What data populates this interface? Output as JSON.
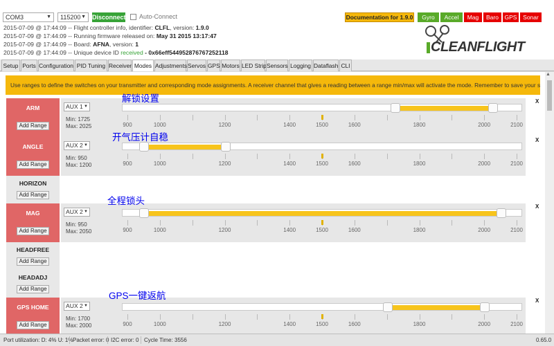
{
  "header": {
    "port_select": "COM3",
    "baud_select": "115200",
    "connect_label": "Disconnect",
    "autoconnect_label": "Auto-Connect",
    "documentation_label": "Documentation for 1.9.0",
    "sensors": [
      {
        "name": "Gyro",
        "color": "#59aa29"
      },
      {
        "name": "Accel",
        "color": "#59aa29"
      },
      {
        "name": "Mag",
        "color": "#e60000"
      },
      {
        "name": "Baro",
        "color": "#e60000"
      },
      {
        "name": "GPS",
        "color": "#e60000"
      },
      {
        "name": "Sonar",
        "color": "#e60000"
      }
    ],
    "logo_text": "CLEANFLIGHT"
  },
  "log": [
    {
      "prefix": "2015-07-09 @ 17:44:09 -- Flight controller info, identifier: ",
      "value": "CLFL",
      "mid": ", version: ",
      "value2": "1.9.0"
    },
    {
      "prefix": "2015-07-09 @ 17:44:09 -- Running firmware released on: ",
      "value": "May 31 2015 13:17:47"
    },
    {
      "prefix": "2015-07-09 @ 17:44:09 -- Board: ",
      "value": "AFNA",
      "mid": ", version: ",
      "value2": "1"
    },
    {
      "prefix": "2015-07-09 @ 17:44:09 -- Unique device ID ",
      "status": "received",
      "value": " - 0x66eff544952876767252118"
    }
  ],
  "tabs": [
    "Setup",
    "Ports",
    "Configuration",
    "PID Tuning",
    "Receiver",
    "Modes",
    "Adjustments",
    "Servos",
    "GPS",
    "Motors",
    "LED Strip",
    "Sensors",
    "Logging",
    "Dataflash",
    "CLI"
  ],
  "active_tab": "Modes",
  "note": "Use ranges to define the switches on your transmitter and corresponding mode assignments. A receiver channel that gives a reading between a range min/max will activate the mode. Remember to save your settings using the Save button.",
  "add_range_label": "Add Range",
  "remove_label": "X",
  "scale_labels": [
    "900",
    "1000",
    "1200",
    "1400",
    "1500",
    "1600",
    "1800",
    "2000",
    "2100"
  ],
  "scale_min": 900,
  "scale_max": 2100,
  "scale_ticks": [
    900,
    1000,
    1100,
    1200,
    1300,
    1400,
    1500,
    1600,
    1700,
    1800,
    1900,
    2000,
    2100
  ],
  "scale_marker": 1500,
  "modes": [
    {
      "name": "ARM",
      "active": true,
      "ranges": [
        {
          "channel": "AUX 1",
          "min_label": "Min: 1725",
          "max_label": "Max: 2025",
          "min": 1725,
          "max": 2025
        }
      ]
    },
    {
      "name": "ANGLE",
      "active": true,
      "ranges": [
        {
          "channel": "AUX 2",
          "min_label": "Min: 950",
          "max_label": "Max: 1200",
          "min": 950,
          "max": 1200
        }
      ]
    },
    {
      "name": "HORIZON",
      "active": false,
      "ranges": []
    },
    {
      "name": "MAG",
      "active": true,
      "ranges": [
        {
          "channel": "AUX 2",
          "min_label": "Min: 950",
          "max_label": "Max: 2050",
          "min": 950,
          "max": 2050
        }
      ]
    },
    {
      "name": "HEADFREE",
      "active": false,
      "ranges": []
    },
    {
      "name": "HEADADJ",
      "active": false,
      "ranges": []
    },
    {
      "name": "GPS HOME",
      "active": true,
      "ranges": [
        {
          "channel": "AUX 2",
          "min_label": "Min: 1700",
          "max_label": "Max: 2000",
          "min": 1700,
          "max": 2000
        }
      ]
    }
  ],
  "annotations": [
    "解锁设置",
    "开气压计自稳",
    "全程锁头",
    "GPS一键返航"
  ],
  "status": {
    "port_util": "Port utilization: D: 4% U: 1%",
    "packet_error": "Packet error: 0",
    "i2c_error": "I2C error: 0",
    "cycle_time": "Cycle Time: 3556",
    "version": "0.65.0"
  }
}
